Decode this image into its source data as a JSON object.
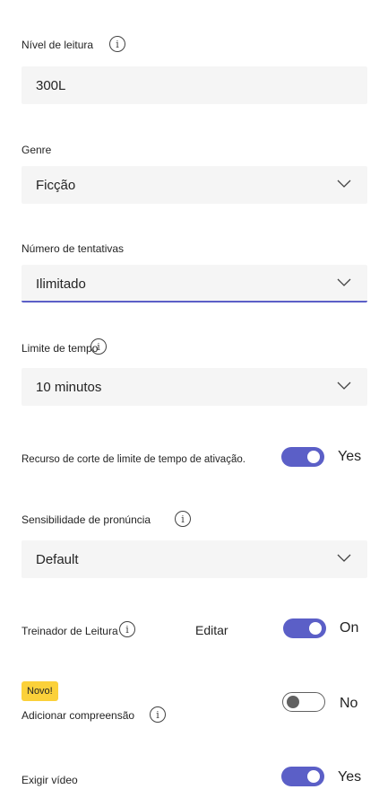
{
  "reading_level": {
    "label": "Nível de leitura",
    "value": "300L"
  },
  "genre": {
    "label": "Genre",
    "value": "Ficção"
  },
  "attempts": {
    "label": "Número de tentativas",
    "value": "Ilimitado"
  },
  "time_limit": {
    "label": "Limite de tempo",
    "value": "10 minutos"
  },
  "time_limit_cutoff": {
    "label": "Recurso de corte de limite de tempo de ativação.",
    "state": "Yes",
    "on": true
  },
  "pronunciation": {
    "label": "Sensibilidade de pronúncia",
    "value": "Default"
  },
  "reading_coach": {
    "label": "Treinador de Leitura",
    "edit_label": "Editar",
    "state": "On",
    "on": true
  },
  "comprehension": {
    "badge": "Novo!",
    "label": "Adicionar compreensão",
    "state": "No",
    "on": false
  },
  "require_video": {
    "label": "Exigir vídeo",
    "state": "Yes",
    "on": true
  },
  "icons": {
    "info": "info-icon",
    "chevron": "chevron-down-icon"
  },
  "colors": {
    "accent": "#5b5fc7",
    "field_bg": "#f5f5f5",
    "badge": "#fbd13a"
  }
}
